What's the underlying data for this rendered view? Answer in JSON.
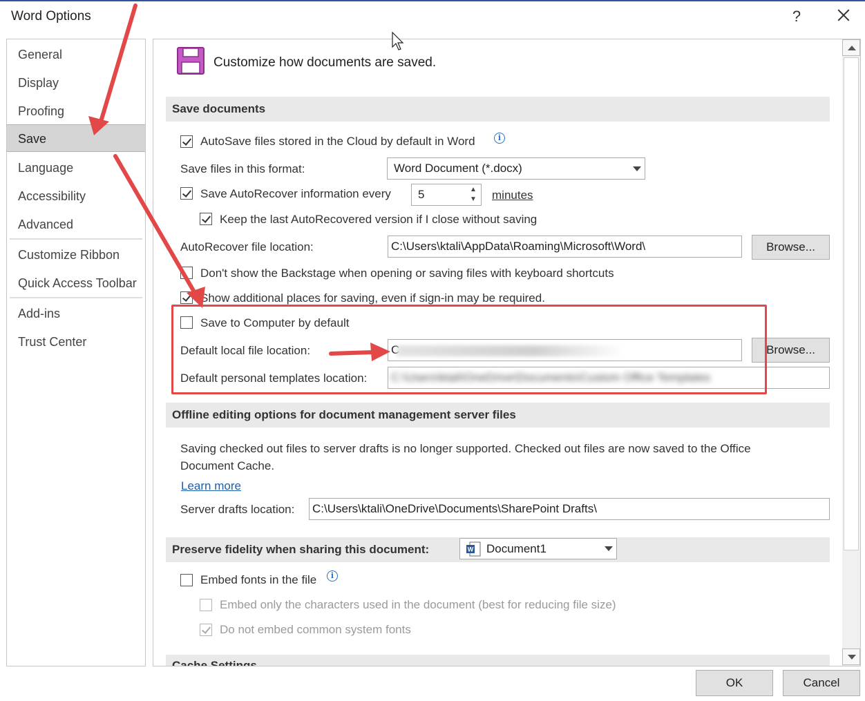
{
  "window": {
    "title": "Word Options",
    "help_label": "?",
    "close_label": "Close"
  },
  "sidebar": {
    "items": [
      {
        "label": "General"
      },
      {
        "label": "Display"
      },
      {
        "label": "Proofing"
      },
      {
        "label": "Save",
        "selected": true
      },
      {
        "label": "Language"
      },
      {
        "label": "Accessibility"
      },
      {
        "label": "Advanced"
      },
      {
        "label": "Customize Ribbon"
      },
      {
        "label": "Quick Access Toolbar"
      },
      {
        "label": "Add-ins"
      },
      {
        "label": "Trust Center"
      }
    ]
  },
  "header": {
    "icon": "save-floppy-icon",
    "text": "Customize how documents are saved."
  },
  "save_documents": {
    "title": "Save documents",
    "autosave_label": "AutoSave files stored in the Cloud by default in Word",
    "autosave_checked": true,
    "format_label": "Save files in this format:",
    "format_value": "Word Document (*.docx)",
    "autorecover_label": "Save AutoRecover information every",
    "autorecover_checked": true,
    "autorecover_minutes": "5",
    "minutes_label": "minutes",
    "keep_last_label": "Keep the last AutoRecovered version if I close without saving",
    "keep_last_checked": true,
    "autorecover_location_label": "AutoRecover file location:",
    "autorecover_location_value": "C:\\Users\\ktali\\AppData\\Roaming\\Microsoft\\Word\\",
    "browse_label": "Browse...",
    "backstage_label": "Don't show the Backstage when opening or saving files with keyboard shortcuts",
    "backstage_checked": false,
    "additional_places_label": "Show additional places for saving, even if sign-in may be required.",
    "additional_places_checked": true,
    "save_to_computer_label": "Save to Computer by default",
    "save_to_computer_checked": false,
    "default_local_label": "Default local file location:",
    "default_local_value": "C",
    "browse2_label": "Browse...",
    "templates_label": "Default personal templates location:",
    "templates_value": "C:\\Users\\ktali\\OneDrive\\Documents\\Custom Office Templates"
  },
  "offline": {
    "title": "Offline editing options for document management server files",
    "description": "Saving checked out files to server drafts is no longer supported. Checked out files are now saved to the Office Document Cache.",
    "learn_more": "Learn more",
    "server_drafts_label": "Server drafts location:",
    "server_drafts_value": "C:\\Users\\ktali\\OneDrive\\Documents\\SharePoint Drafts\\"
  },
  "fidelity": {
    "title": "Preserve fidelity when sharing this document:",
    "document_value": "Document1",
    "embed_fonts_label": "Embed fonts in the file",
    "embed_fonts_checked": false,
    "embed_chars_label": "Embed only the characters used in the document (best for reducing file size)",
    "embed_chars_checked": false,
    "no_common_label": "Do not embed common system fonts",
    "no_common_checked": true,
    "next_section_partial": "Cache Settings"
  },
  "footer": {
    "ok_label": "OK",
    "cancel_label": "Cancel"
  },
  "colors": {
    "annotation_red": "#e24848",
    "selected_nav": "#d5d5d5",
    "link_blue": "#1f5fa8"
  }
}
